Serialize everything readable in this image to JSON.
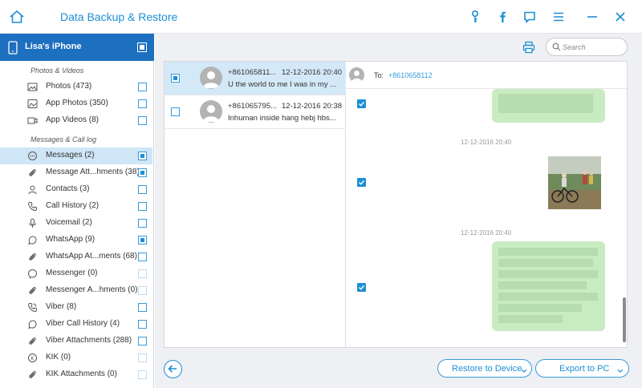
{
  "window": {
    "title": "Data Backup & Restore"
  },
  "device": {
    "name": "Lisa's iPhone",
    "checked": true
  },
  "sidebar": {
    "sections": [
      {
        "title": "Photos & Videos",
        "items": [
          {
            "label": "Photos (473)",
            "icon": "image-icon",
            "checked": false,
            "selected": false,
            "disabled": false
          },
          {
            "label": "App Photos (350)",
            "icon": "app-photo-icon",
            "checked": false,
            "selected": false,
            "disabled": false
          },
          {
            "label": "App Videos (8)",
            "icon": "video-icon",
            "checked": false,
            "selected": false,
            "disabled": false
          }
        ]
      },
      {
        "title": "Messages & Call log",
        "items": [
          {
            "label": "Messages (2)",
            "icon": "message-icon",
            "checked": true,
            "selected": true,
            "disabled": false
          },
          {
            "label": "Message Att...hments (38)",
            "icon": "paperclip-icon",
            "checked": true,
            "selected": false,
            "disabled": false
          },
          {
            "label": "Contacts (3)",
            "icon": "contact-icon",
            "checked": false,
            "selected": false,
            "disabled": false
          },
          {
            "label": "Call History (2)",
            "icon": "phone-icon",
            "checked": false,
            "selected": false,
            "disabled": false
          },
          {
            "label": "Voicemail (2)",
            "icon": "microphone-icon",
            "checked": false,
            "selected": false,
            "disabled": false
          },
          {
            "label": "WhatsApp (9)",
            "icon": "whatsapp-icon",
            "checked": true,
            "selected": false,
            "disabled": false
          },
          {
            "label": "WhatsApp At...ments (68)",
            "icon": "paperclip-icon",
            "checked": false,
            "selected": false,
            "disabled": false
          },
          {
            "label": "Messenger (0)",
            "icon": "messenger-icon",
            "checked": false,
            "selected": false,
            "disabled": true
          },
          {
            "label": "Messenger A...hments (0)",
            "icon": "paperclip-icon",
            "checked": false,
            "selected": false,
            "disabled": true
          },
          {
            "label": "Viber (8)",
            "icon": "viber-icon",
            "checked": false,
            "selected": false,
            "disabled": false
          },
          {
            "label": "Viber Call History (4)",
            "icon": "viber-icon",
            "checked": false,
            "selected": false,
            "disabled": false
          },
          {
            "label": "Viber Attachments (288)",
            "icon": "paperclip-icon",
            "checked": false,
            "selected": false,
            "disabled": false
          },
          {
            "label": "KIK (0)",
            "icon": "kik-icon",
            "checked": false,
            "selected": false,
            "disabled": true
          },
          {
            "label": "KIK Attachments (0)",
            "icon": "paperclip-icon",
            "checked": false,
            "selected": false,
            "disabled": true
          }
        ]
      }
    ]
  },
  "search": {
    "placeholder": "Search",
    "value": ""
  },
  "messages": [
    {
      "sender": "+861065811...",
      "time": "12-12-2016 20:40",
      "preview": "U the world to me I was in my ...",
      "checked": true,
      "selected": true
    },
    {
      "sender": "+861065795...",
      "time": "12-12-2016 20:38",
      "preview": "Inhuman inside hang hebj hbs...",
      "checked": false,
      "selected": false
    }
  ],
  "conversation": {
    "to_label": "To:",
    "to_number": "+8610658112",
    "timestamps": [
      "12-12-2016 20:40",
      "12-12-2016 20:40"
    ]
  },
  "buttons": {
    "restore": "Restore to Device",
    "export": "Export to PC"
  },
  "colors": {
    "accent": "#1d8fd6",
    "device_header": "#1d6fbf",
    "selected_row": "#d4e9f8",
    "bubble": "#c9ebc2"
  }
}
